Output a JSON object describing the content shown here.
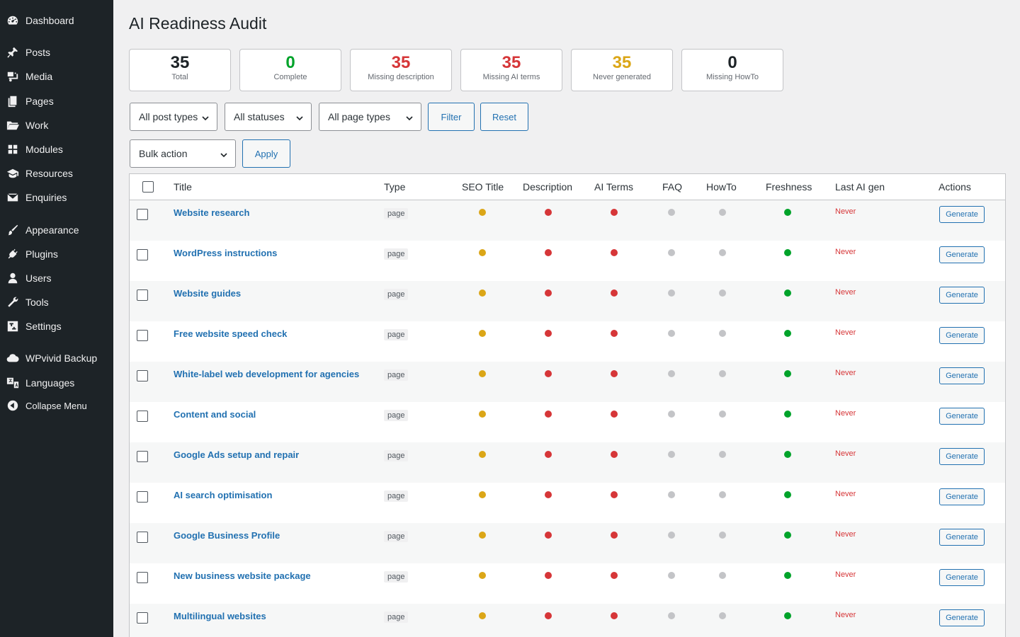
{
  "sidebar": {
    "items": [
      {
        "label": "Dashboard",
        "icon": "dashboard-icon"
      },
      {
        "label": "Posts",
        "icon": "pushpin-icon"
      },
      {
        "label": "Media",
        "icon": "media-icon"
      },
      {
        "label": "Pages",
        "icon": "pages-icon"
      },
      {
        "label": "Work",
        "icon": "folder-icon"
      },
      {
        "label": "Modules",
        "icon": "grid-icon"
      },
      {
        "label": "Resources",
        "icon": "graduation-cap-icon"
      },
      {
        "label": "Enquiries",
        "icon": "envelope-icon"
      },
      {
        "label": "Appearance",
        "icon": "paintbrush-icon"
      },
      {
        "label": "Plugins",
        "icon": "plug-icon"
      },
      {
        "label": "Users",
        "icon": "user-icon"
      },
      {
        "label": "Tools",
        "icon": "wrench-icon"
      },
      {
        "label": "Settings",
        "icon": "settings-icon"
      },
      {
        "label": "WPvivid Backup",
        "icon": "cloud-icon"
      },
      {
        "label": "Languages",
        "icon": "translate-icon"
      },
      {
        "label": "Collapse Menu",
        "icon": "collapse-arrow-icon"
      }
    ]
  },
  "page": {
    "title": "AI Readiness Audit"
  },
  "stats": [
    {
      "value": "35",
      "label": "Total",
      "color": "#1d2327"
    },
    {
      "value": "0",
      "label": "Complete",
      "color": "#00a32a"
    },
    {
      "value": "35",
      "label": "Missing description",
      "color": "#d63638"
    },
    {
      "value": "35",
      "label": "Missing AI terms",
      "color": "#d63638"
    },
    {
      "value": "35",
      "label": "Never generated",
      "color": "#dba617"
    },
    {
      "value": "0",
      "label": "Missing HowTo",
      "color": "#1d2327"
    }
  ],
  "filters": {
    "post_type": "All post types",
    "status": "All statuses",
    "page_type": "All page types",
    "filter_label": "Filter",
    "reset_label": "Reset",
    "bulk_action": "Bulk action",
    "apply_label": "Apply"
  },
  "table": {
    "headers": {
      "title": "Title",
      "type": "Type",
      "seo_title": "SEO Title",
      "description": "Description",
      "ai_terms": "AI Terms",
      "faq": "FAQ",
      "howto": "HowTo",
      "freshness": "Freshness",
      "last_ai_gen": "Last AI gen",
      "actions": "Actions"
    },
    "status_colors": {
      "amber": "#dba617",
      "red": "#d63638",
      "grey": "#c3c4c7",
      "green": "#00a32a"
    },
    "rows": [
      {
        "title": "Website research",
        "type": "page",
        "seo_title": "amber",
        "description": "red",
        "ai_terms": "red",
        "faq": "grey",
        "howto": "grey",
        "freshness": "green",
        "last_ai_gen": "Never",
        "action": "Generate"
      },
      {
        "title": "WordPress instructions",
        "type": "page",
        "seo_title": "amber",
        "description": "red",
        "ai_terms": "red",
        "faq": "grey",
        "howto": "grey",
        "freshness": "green",
        "last_ai_gen": "Never",
        "action": "Generate"
      },
      {
        "title": "Website guides",
        "type": "page",
        "seo_title": "amber",
        "description": "red",
        "ai_terms": "red",
        "faq": "grey",
        "howto": "grey",
        "freshness": "green",
        "last_ai_gen": "Never",
        "action": "Generate"
      },
      {
        "title": "Free website speed check",
        "type": "page",
        "seo_title": "amber",
        "description": "red",
        "ai_terms": "red",
        "faq": "grey",
        "howto": "grey",
        "freshness": "green",
        "last_ai_gen": "Never",
        "action": "Generate"
      },
      {
        "title": "White-label web development for agencies",
        "type": "page",
        "seo_title": "amber",
        "description": "red",
        "ai_terms": "red",
        "faq": "grey",
        "howto": "grey",
        "freshness": "green",
        "last_ai_gen": "Never",
        "action": "Generate"
      },
      {
        "title": "Content and social",
        "type": "page",
        "seo_title": "amber",
        "description": "red",
        "ai_terms": "red",
        "faq": "grey",
        "howto": "grey",
        "freshness": "green",
        "last_ai_gen": "Never",
        "action": "Generate"
      },
      {
        "title": "Google Ads setup and repair",
        "type": "page",
        "seo_title": "amber",
        "description": "red",
        "ai_terms": "red",
        "faq": "grey",
        "howto": "grey",
        "freshness": "green",
        "last_ai_gen": "Never",
        "action": "Generate"
      },
      {
        "title": "AI search optimisation",
        "type": "page",
        "seo_title": "amber",
        "description": "red",
        "ai_terms": "red",
        "faq": "grey",
        "howto": "grey",
        "freshness": "green",
        "last_ai_gen": "Never",
        "action": "Generate"
      },
      {
        "title": "Google Business Profile",
        "type": "page",
        "seo_title": "amber",
        "description": "red",
        "ai_terms": "red",
        "faq": "grey",
        "howto": "grey",
        "freshness": "green",
        "last_ai_gen": "Never",
        "action": "Generate"
      },
      {
        "title": "New business website package",
        "type": "page",
        "seo_title": "amber",
        "description": "red",
        "ai_terms": "red",
        "faq": "grey",
        "howto": "grey",
        "freshness": "green",
        "last_ai_gen": "Never",
        "action": "Generate"
      },
      {
        "title": "Multilingual websites",
        "type": "page",
        "seo_title": "amber",
        "description": "red",
        "ai_terms": "red",
        "faq": "grey",
        "howto": "grey",
        "freshness": "green",
        "last_ai_gen": "Never",
        "action": "Generate"
      }
    ]
  }
}
